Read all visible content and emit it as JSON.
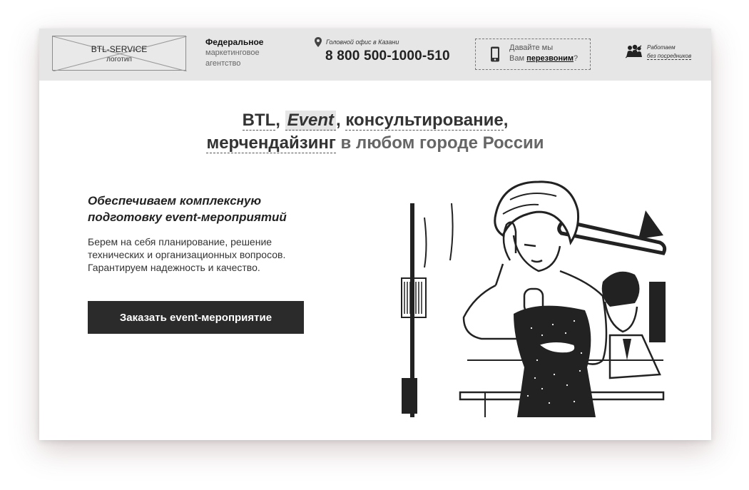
{
  "header": {
    "logo": {
      "line1": "BTL-SERVICE",
      "line2": "логотип"
    },
    "agency": {
      "line1": "Федеральное",
      "line2": "маркетинговое",
      "line3": "агентство"
    },
    "office_label": "Головной офис в Казани",
    "phone": "8 800 500-1000-510",
    "callback": {
      "line1": "Давайте мы",
      "line2_prefix": "Вам ",
      "line2_link": "перезвоним",
      "line2_suffix": "?"
    },
    "direct": {
      "line1": "Работаем",
      "line2": "без посредников"
    }
  },
  "hero": {
    "headline": {
      "part1": "BTL",
      "sep1": ", ",
      "part2": "Event",
      "sep2": ", ",
      "part3": "консультирование",
      "sep3": ",",
      "part4": "мерчендайзинг",
      "part5": " в любом городе России"
    },
    "subheading": "Обеспечиваем комплексную подготовку event-мероприятий",
    "description": "Берем на себя планирование, решение технических и организационных вопросов. Гарантируем надежность и качество.",
    "cta_label": "Заказать event-мероприятие"
  },
  "icons": {
    "pin": "location-pin-icon",
    "phone": "mobile-phone-icon",
    "people": "people-icon"
  }
}
